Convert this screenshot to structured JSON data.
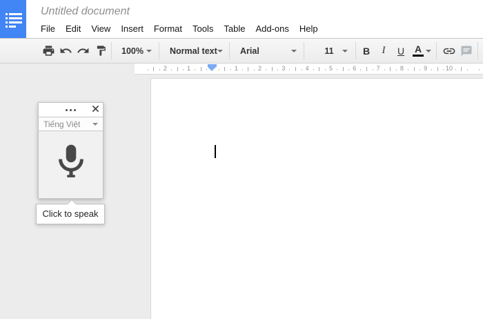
{
  "window": {
    "doc_title": "Untitled document"
  },
  "menu_bar": {
    "items": [
      "File",
      "Edit",
      "View",
      "Insert",
      "Format",
      "Tools",
      "Table",
      "Add-ons",
      "Help"
    ]
  },
  "toolbar": {
    "zoom_value": "100%",
    "paragraph_style": "Normal text",
    "font_family": "Arial",
    "font_size": "11",
    "bold_label": "B",
    "italic_label": "I",
    "underline_label": "U",
    "text_color_label": "A",
    "icons": [
      "print-icon",
      "undo-icon",
      "redo-icon",
      "paint-format-icon",
      "link-icon",
      "comment-icon"
    ]
  },
  "ruler": {
    "numbers_left": [
      "2",
      "1"
    ],
    "numbers_right": [
      "1",
      "2",
      "3",
      "4",
      "5",
      "6",
      "7",
      "8",
      "9",
      "10"
    ]
  },
  "voice_typing_panel": {
    "language": "Tiếng Việt",
    "tooltip": "Click to speak"
  },
  "colors": {
    "accent_blue": "#4285f4",
    "ruler_marker_blue": "#7baaf7",
    "mic_gray": "#484848",
    "canvas_gray": "#ececec"
  }
}
